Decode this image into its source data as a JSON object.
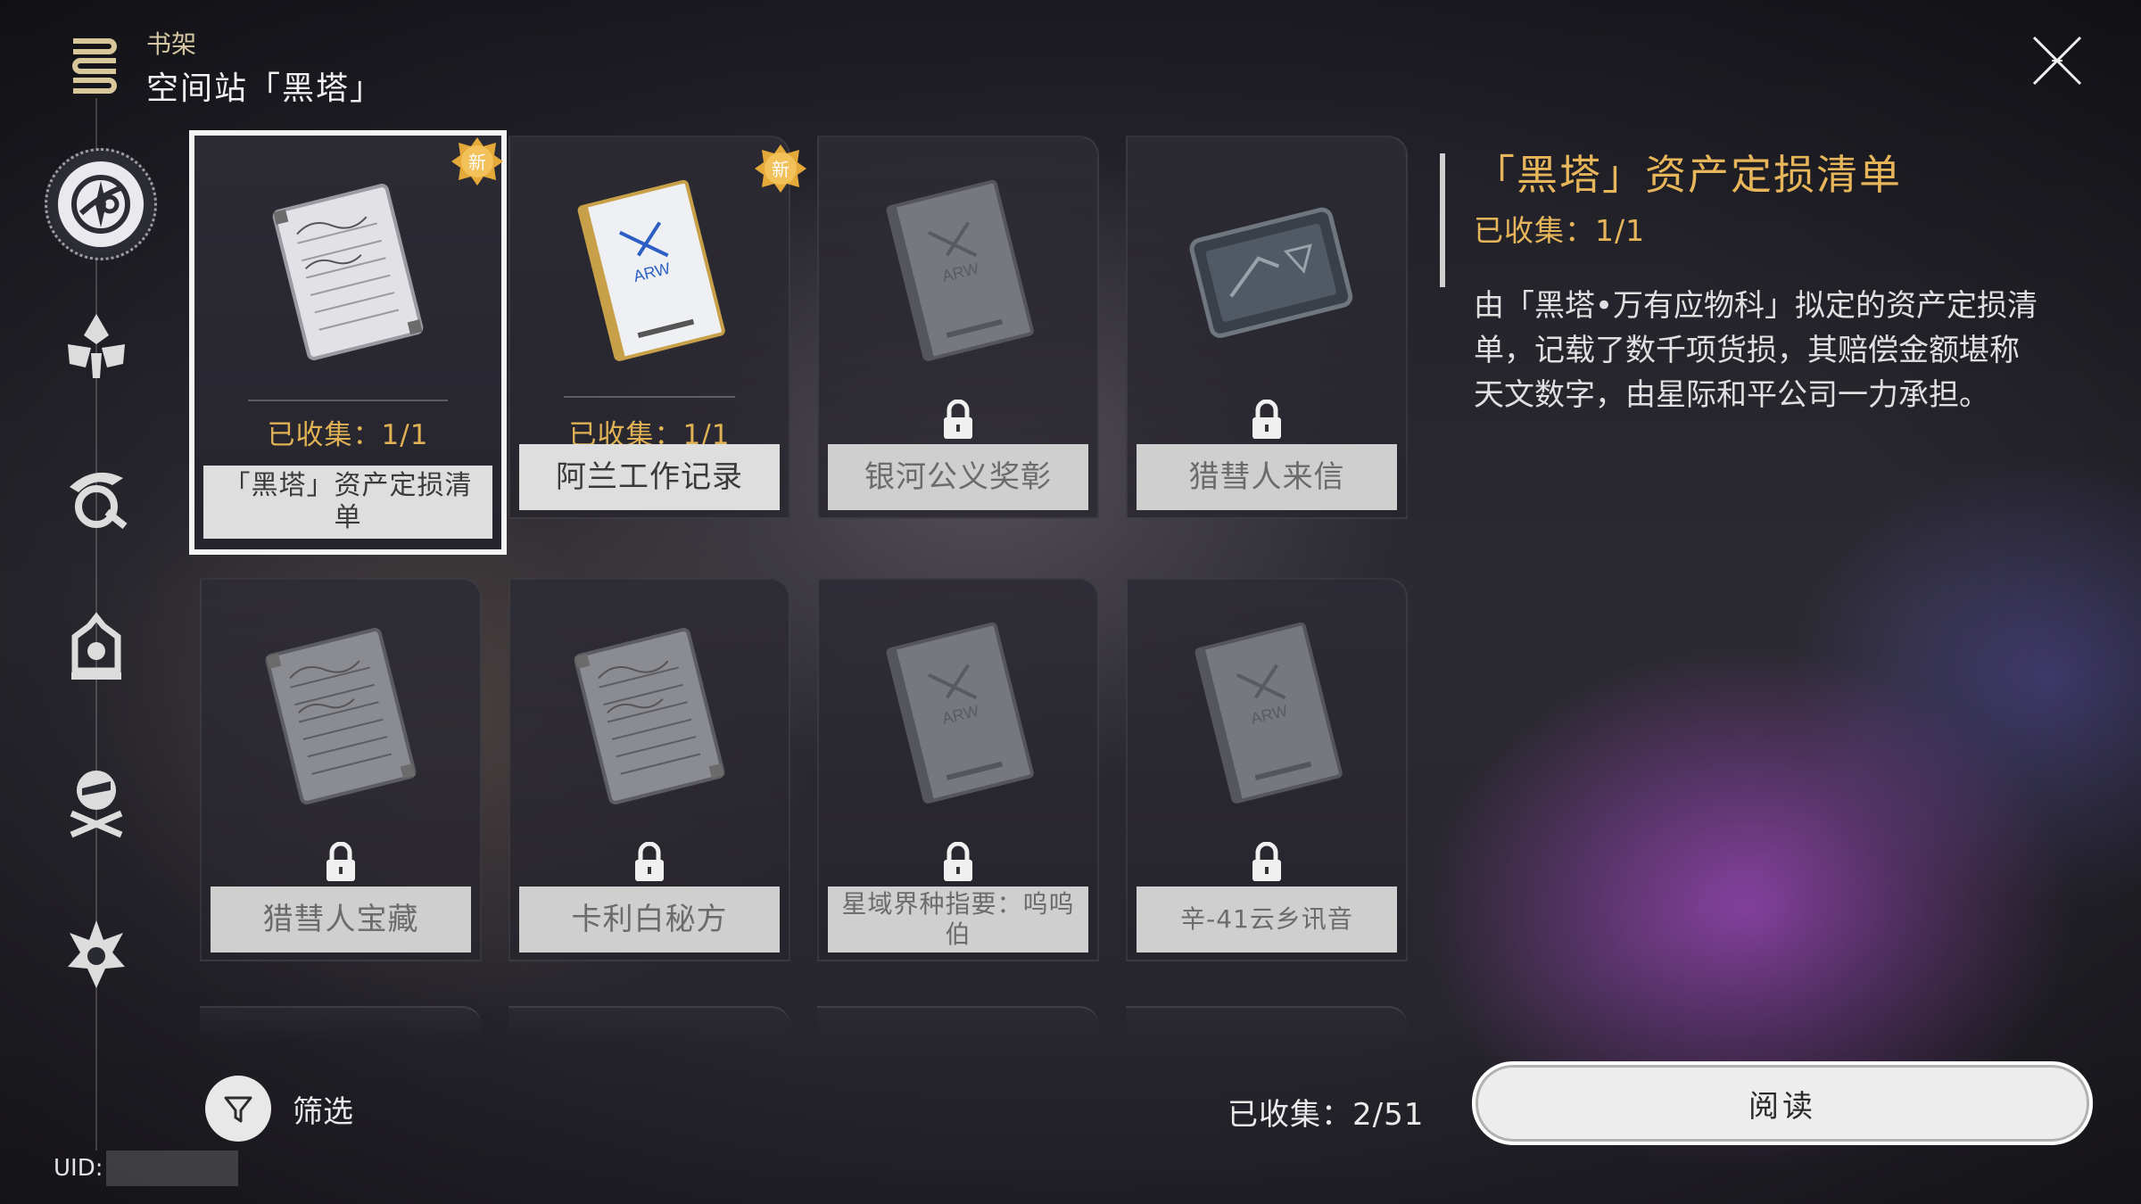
{
  "header": {
    "breadcrumb": "书架",
    "title": "空间站「黑塔」"
  },
  "sidebar": {
    "items": [
      {
        "name": "space-station-emblem-icon",
        "active": true
      },
      {
        "name": "lotus-emblem-icon",
        "active": false
      },
      {
        "name": "dragon-emblem-icon",
        "active": false
      },
      {
        "name": "bell-emblem-icon",
        "active": false
      },
      {
        "name": "skull-emblem-icon",
        "active": false
      },
      {
        "name": "flame-emblem-icon",
        "active": false
      }
    ]
  },
  "books": [
    {
      "title": "「黑塔」资产定损清单",
      "collected": "已收集：1/1",
      "locked": false,
      "is_new": true,
      "selected": true,
      "art": "notebook-icon"
    },
    {
      "title": "阿兰工作记录",
      "collected": "已收集：1/1",
      "locked": false,
      "is_new": true,
      "selected": false,
      "art": "report-book-icon"
    },
    {
      "title": "银河公义奖彰",
      "collected": "",
      "locked": true,
      "is_new": false,
      "selected": false,
      "art": "report-book-icon"
    },
    {
      "title": "猎彗人来信",
      "collected": "",
      "locked": true,
      "is_new": false,
      "selected": false,
      "art": "tablet-icon"
    },
    {
      "title": "猎彗人宝藏",
      "collected": "",
      "locked": true,
      "is_new": false,
      "selected": false,
      "art": "notebook-icon"
    },
    {
      "title": "卡利白秘方",
      "collected": "",
      "locked": true,
      "is_new": false,
      "selected": false,
      "art": "notebook-icon"
    },
    {
      "title": "星域界种指要：呜呜伯",
      "collected": "",
      "locked": true,
      "is_new": false,
      "selected": false,
      "art": "report-book-icon"
    },
    {
      "title": "辛-41云乡讯音",
      "collected": "",
      "locked": true,
      "is_new": false,
      "selected": false,
      "art": "report-book-icon"
    }
  ],
  "new_badge_label": "新",
  "detail": {
    "title": "「黑塔」资产定损清单",
    "collected": "已收集：1/1",
    "description": "由「黑塔•万有应物科」拟定的资产定损清单，记载了数千项货损，其赔偿金额堪称天文数字，由星际和平公司一力承担。",
    "read_label": "阅读"
  },
  "filter": {
    "label": "筛选"
  },
  "total_collected": "已收集：2/51",
  "uid_label": "UID:",
  "colors": {
    "accent_gold": "#e7b55a",
    "selected_border": "#f4f4f4",
    "label_bg": "#dedede"
  }
}
